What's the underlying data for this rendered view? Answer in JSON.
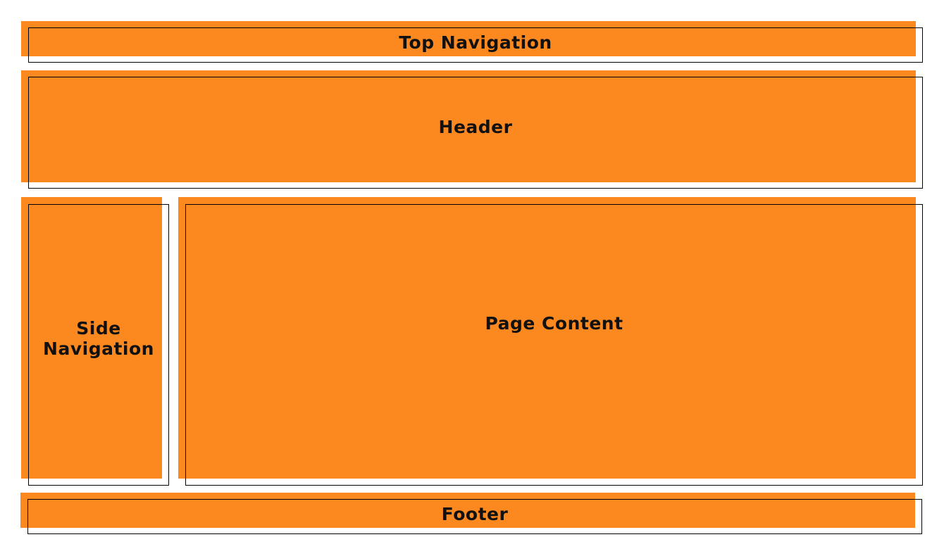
{
  "colors": {
    "block_fill": "#fc891f",
    "outline": "#000000",
    "text": "#111111",
    "background": "#ffffff"
  },
  "blocks": {
    "top_navigation": {
      "label": "Top Navigation"
    },
    "header": {
      "label": "Header"
    },
    "side_navigation": {
      "label": "Side Navigation"
    },
    "page_content": {
      "label": "Page Content"
    },
    "footer": {
      "label": "Footer"
    }
  }
}
